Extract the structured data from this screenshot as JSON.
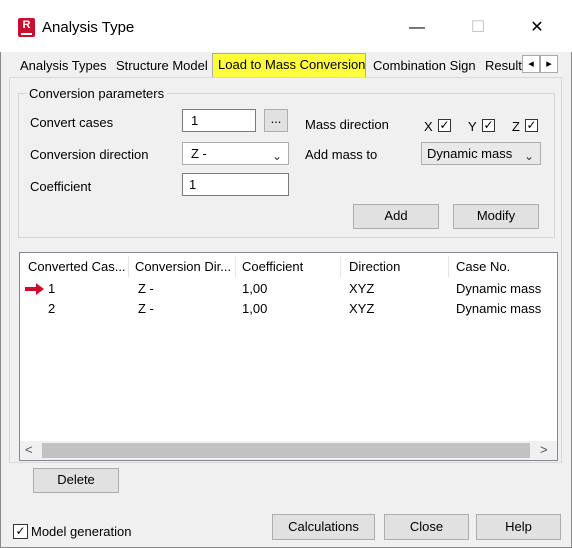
{
  "window": {
    "title": "Analysis Type",
    "icon_name": "revit-app-icon",
    "icon_letter": "R",
    "minimize_glyph": "—",
    "maximize_glyph": "☐",
    "close_glyph": "✕"
  },
  "tabs": [
    {
      "label": "Analysis Types",
      "active": false
    },
    {
      "label": "Structure Model",
      "active": false
    },
    {
      "label": "Load to Mass Conversion",
      "active": true,
      "highlight": "#ffff3c"
    },
    {
      "label": "Combination Sign",
      "active": false
    },
    {
      "label": "Result",
      "active": false
    }
  ],
  "tab_scroll": {
    "left": "◂",
    "right": "▸"
  },
  "conversion": {
    "group_title": "Conversion parameters",
    "convert_cases_label": "Convert cases",
    "convert_cases_value": "1",
    "browse_label": "...",
    "direction_label": "Conversion direction",
    "direction_value": "Z -",
    "coefficient_label": "Coefficient",
    "coefficient_value": "1",
    "mass_direction_label": "Mass direction",
    "mass_direction": [
      {
        "axis": "X",
        "checked": true
      },
      {
        "axis": "Y",
        "checked": true
      },
      {
        "axis": "Z",
        "checked": true
      }
    ],
    "add_mass_to_label": "Add mass to",
    "add_mass_to_value": "Dynamic mass",
    "add_button": "Add",
    "modify_button": "Modify"
  },
  "table": {
    "columns": [
      "Converted Cas...",
      "Conversion Dir...",
      "Coefficient",
      "Direction",
      "Case No."
    ],
    "rows": [
      {
        "selected_marker": true,
        "cells": [
          "1",
          "Z -",
          "1,00",
          "XYZ",
          "Dynamic mass"
        ]
      },
      {
        "selected_marker": false,
        "cells": [
          "2",
          "Z -",
          "1,00",
          "XYZ",
          "Dynamic mass"
        ]
      }
    ],
    "marker_color": "#c8102e"
  },
  "delete_button": "Delete",
  "model_generation": {
    "label": "Model generation",
    "checked": true
  },
  "footer_buttons": {
    "calculations": "Calculations",
    "close": "Close",
    "help": "Help"
  },
  "scroll_glyphs": {
    "left": "<",
    "right": ">"
  }
}
